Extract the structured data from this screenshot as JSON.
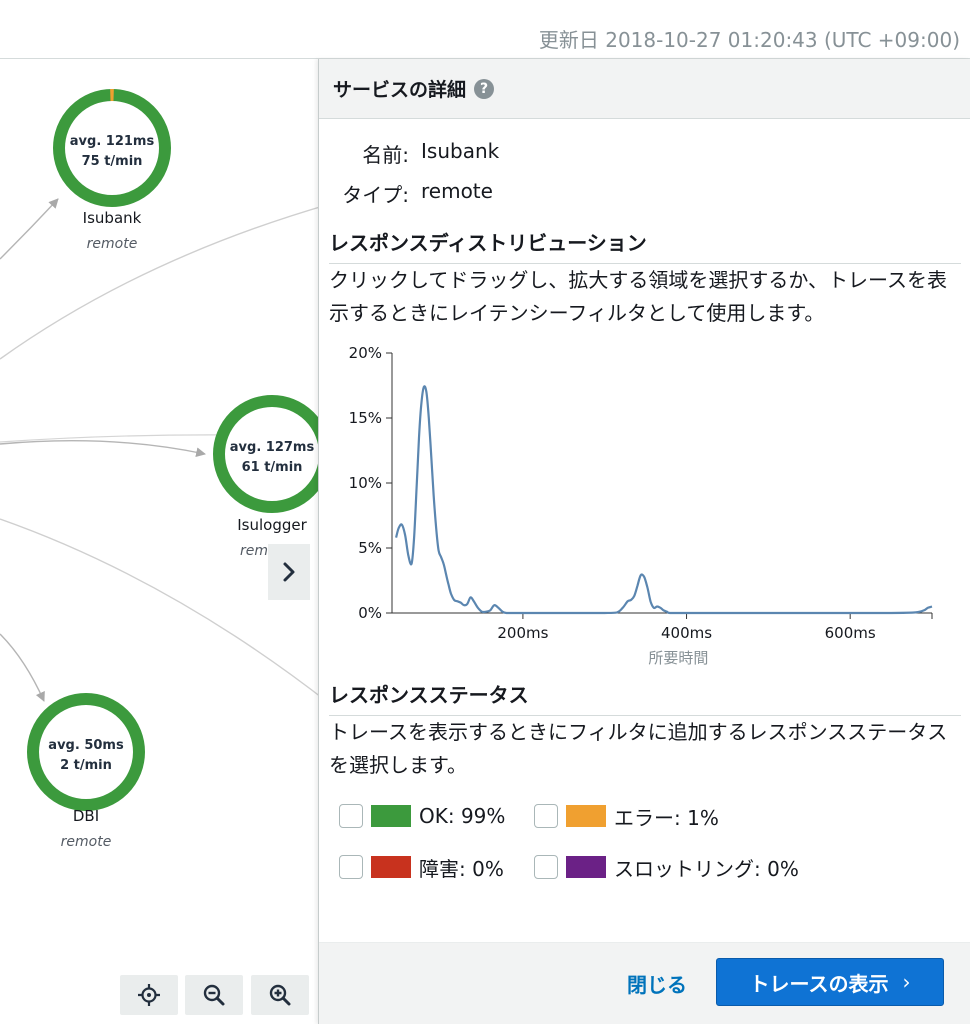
{
  "header": {
    "updated": "更新日 2018-10-27 01:20:43 (UTC +09:00)"
  },
  "colors": {
    "healthy": "#3c9a3d",
    "error": "#f0a030",
    "fault": "#c8321e",
    "throttle": "#6b2186",
    "primary": "#0f73d4",
    "line": "#5b86b0"
  },
  "map": {
    "nodes": [
      {
        "id": "isubank",
        "avg": "avg. 121ms",
        "rate": "75 t/min",
        "name": "Isubank",
        "type": "remote",
        "error_fraction": 0.01
      },
      {
        "id": "isulogger",
        "avg": "avg. 127ms",
        "rate": "61 t/min",
        "name": "Isulogger",
        "type": "rem",
        "error_fraction": 0
      },
      {
        "id": "dbi",
        "avg": "avg. 50ms",
        "rate": "2 t/min",
        "name": "DBI",
        "type": "remote",
        "error_fraction": 0
      }
    ]
  },
  "panel": {
    "title": "サービスの詳細",
    "name_key": "名前:",
    "name_value": "Isubank",
    "type_key": "タイプ:",
    "type_value": "remote",
    "dist_title": "レスポンスディストリビューション",
    "dist_desc": "クリックしてドラッグし、拡大する領域を選択するか、トレースを表示するときにレイテンシーフィルタとして使用します。",
    "status_title": "レスポンスステータス",
    "status_desc": "トレースを表示するときにフィルタに追加するレスポンスステータスを選択します。",
    "statuses": [
      {
        "label": "OK: 99%",
        "color": "#3c9a3d"
      },
      {
        "label": "エラー: 1%",
        "color": "#f0a030"
      },
      {
        "label": "障害: 0%",
        "color": "#c8321e"
      },
      {
        "label": "スロットリング: 0%",
        "color": "#6b2186"
      }
    ],
    "close_label": "閉じる",
    "primary_label": "トレースの表示",
    "primary_chevron": "›"
  },
  "chart_data": {
    "type": "line",
    "title": "",
    "xlabel": "所要時間",
    "ylabel": "",
    "xlim": [
      40,
      700
    ],
    "ylim": [
      0,
      20
    ],
    "x_ticks": [
      200,
      400,
      600
    ],
    "x_tick_labels": [
      "200ms",
      "400ms",
      "600ms"
    ],
    "y_ticks": [
      0,
      5,
      10,
      15,
      20
    ],
    "y_tick_labels": [
      "0%",
      "5%",
      "10%",
      "15%",
      "20%"
    ],
    "grid": false,
    "series": [
      {
        "name": "",
        "x": [
          45,
          48,
          52,
          56,
          60,
          64,
          67,
          70,
          73,
          76,
          79,
          82,
          85,
          88,
          91,
          94,
          97,
          100,
          103,
          106,
          109,
          112,
          116,
          120,
          124,
          128,
          132,
          136,
          140,
          145,
          150,
          155,
          160,
          165,
          170,
          175,
          180,
          190,
          200,
          220,
          240,
          260,
          280,
          300,
          315,
          322,
          328,
          332,
          336,
          340,
          344,
          348,
          352,
          356,
          360,
          364,
          368,
          372,
          376,
          380,
          400,
          450,
          500,
          550,
          600,
          650,
          680,
          690,
          695,
          700
        ],
        "y": [
          5.8,
          6.5,
          6.8,
          6.0,
          4.4,
          3.8,
          5.8,
          9.5,
          13.5,
          16.2,
          17.4,
          17.0,
          15.0,
          12.0,
          9.0,
          6.5,
          4.8,
          4.3,
          3.8,
          3.0,
          2.2,
          1.5,
          1.0,
          0.9,
          0.8,
          0.6,
          0.7,
          1.2,
          0.9,
          0.4,
          0.1,
          0.1,
          0.2,
          0.6,
          0.4,
          0.1,
          0.0,
          0.0,
          0.0,
          0.0,
          0.0,
          0.0,
          0.0,
          0.0,
          0.05,
          0.4,
          0.9,
          1.0,
          1.3,
          2.1,
          2.9,
          2.8,
          2.0,
          0.9,
          0.4,
          0.5,
          0.4,
          0.2,
          0.1,
          0.0,
          0.0,
          0.0,
          0.0,
          0.0,
          0.0,
          0.0,
          0.05,
          0.2,
          0.4,
          0.5
        ]
      }
    ]
  }
}
